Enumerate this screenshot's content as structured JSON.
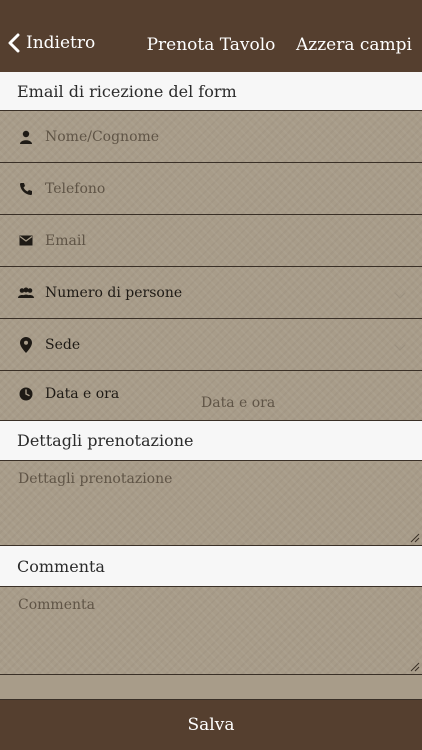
{
  "navbar": {
    "back_label": "Indietro",
    "title": "Prenota Tavolo",
    "reset_label": "Azzera campi"
  },
  "form": {
    "email_section_label": "Email di ricezione del form",
    "fields": {
      "name_placeholder": "Nome/Cognome",
      "phone_placeholder": "Telefono",
      "email_placeholder": "Email",
      "people_label": "Numero di persone",
      "location_label": "Sede",
      "datetime_label": "Data e ora",
      "datetime_placeholder": "Data e ora"
    },
    "details_section_label": "Dettagli prenotazione",
    "details_placeholder": "Dettagli prenotazione",
    "comment_section_label": "Commenta",
    "comment_placeholder": "Commenta"
  },
  "footer": {
    "save_label": "Salva"
  },
  "colors": {
    "bar": "#553f2f",
    "field_background": "#a89c89",
    "header_background": "#f7f7f7"
  },
  "icons": {
    "back": "chevron-left-icon",
    "name": "person-icon",
    "phone": "phone-icon",
    "email": "envelope-icon",
    "people": "group-icon",
    "location": "map-pin-icon",
    "datetime": "clock-icon"
  }
}
